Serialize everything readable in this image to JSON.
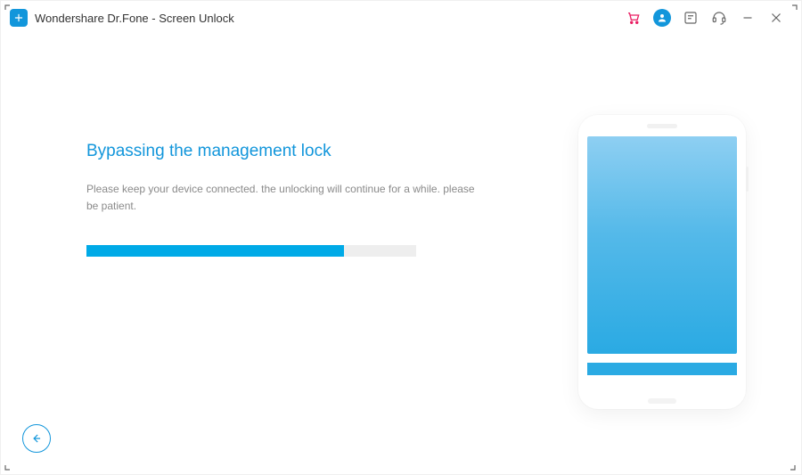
{
  "app": {
    "title": "Wondershare Dr.Fone - Screen Unlock"
  },
  "main": {
    "heading": "Bypassing the management lock",
    "subtext": "Please keep your device connected. the unlocking will continue for a while. please be patient.",
    "progress_percent": 78
  },
  "colors": {
    "accent": "#1296db",
    "progress": "#00aae7",
    "cart": "#e91e63"
  }
}
